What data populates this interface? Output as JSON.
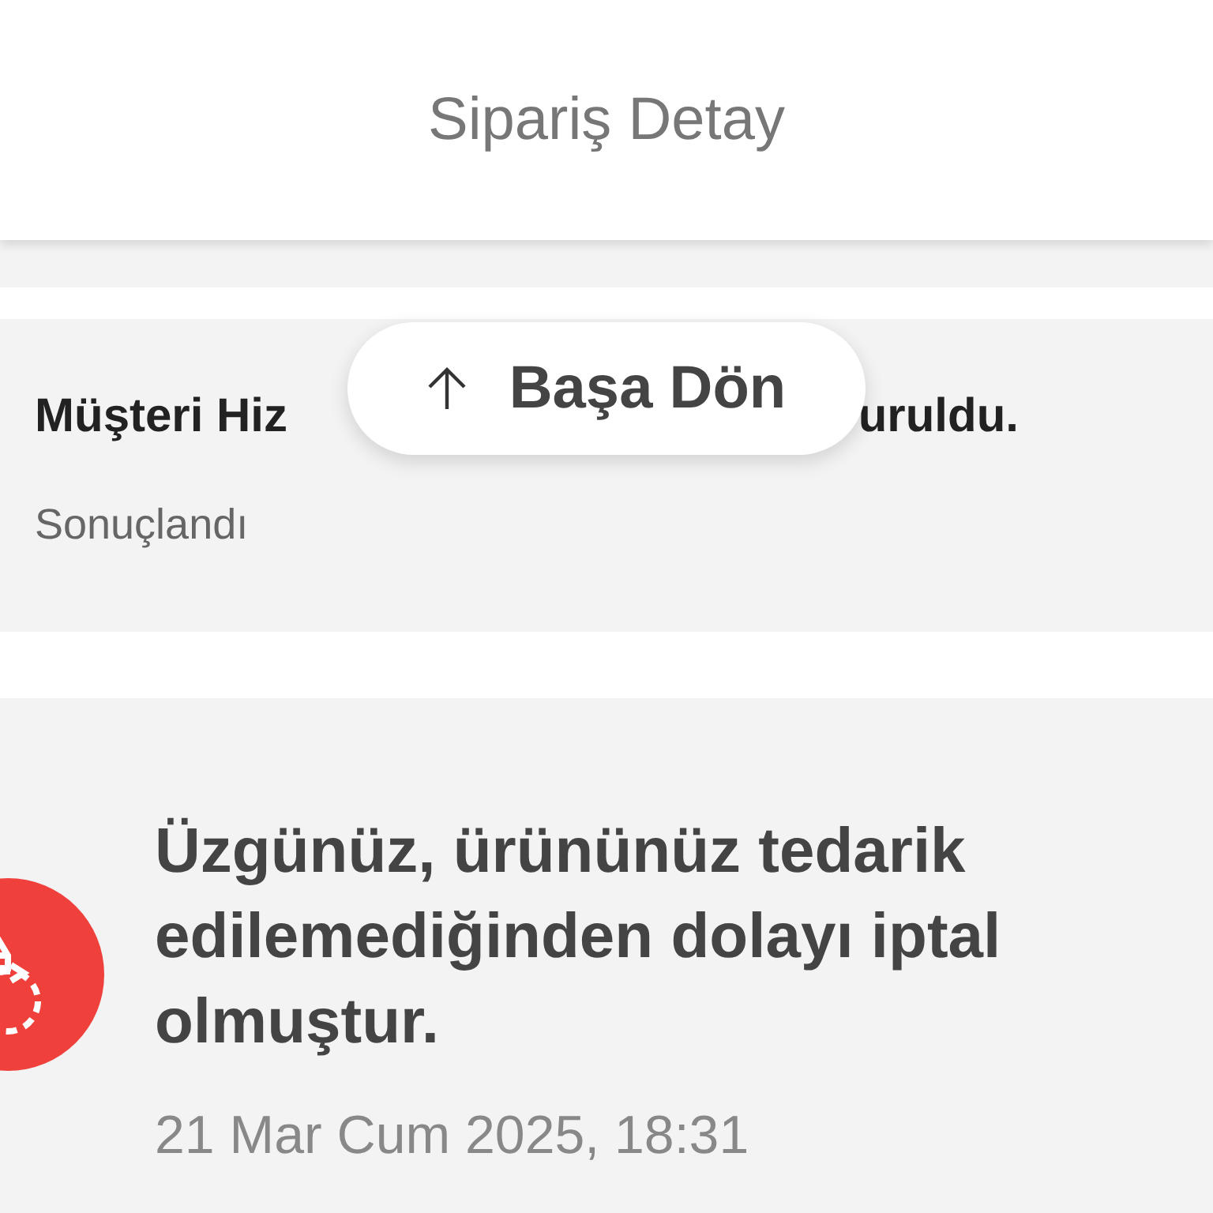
{
  "header": {
    "title": "Sipariş Detay"
  },
  "back_to_top": {
    "label": "Başa Dön"
  },
  "request_card": {
    "title_start": "Müşteri Hiz",
    "title_end": "uruldu.",
    "status": "Sonuçlandı"
  },
  "cancel_card": {
    "message": "Üzgünüz, ürününüz tedarik edilemediğinden dolayı iptal olmuştur.",
    "date": "21 Mar Cum 2025, 18:31"
  }
}
